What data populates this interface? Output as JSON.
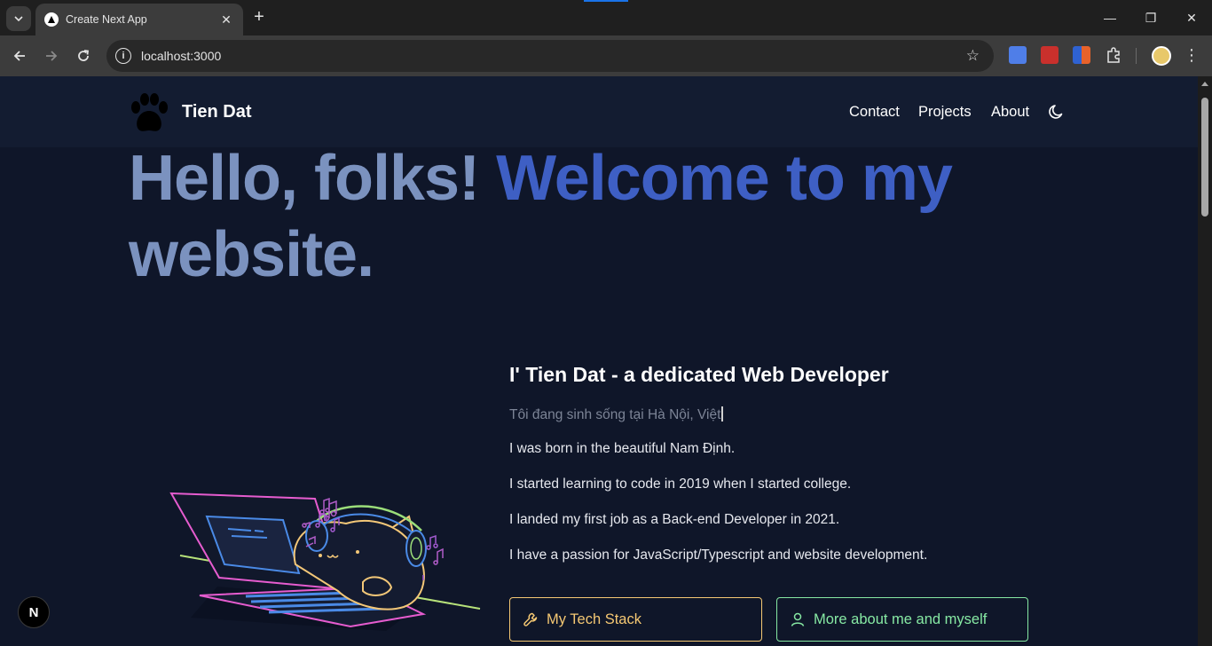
{
  "browser": {
    "tab_title": "Create Next App",
    "tab_close": "✕",
    "new_tab": "+",
    "url": "localhost:3000",
    "window_controls": {
      "minimize": "—",
      "restore": "❐",
      "close": "✕"
    }
  },
  "site": {
    "brand": "Tien Dat",
    "nav": [
      "Contact",
      "Projects",
      "About"
    ],
    "hero": {
      "part1": "Hello, folks! ",
      "part2": "Welcome to my",
      "part3": "website."
    },
    "intro": {
      "title": "I' Tien Dat - a dedicated Web Developer",
      "typing": "Tôi đang sinh sống tại  Hà Nội, Việt",
      "paragraphs": [
        "I was born in the beautiful Nam Định.",
        "I started learning to code in 2019 when I started college.",
        "I landed my first job as a Back-end Developer in 2021.",
        "I have a passion for JavaScript/Typescript and website development."
      ]
    },
    "buttons": {
      "tech_stack": "My Tech Stack",
      "about_me": "More about me and myself"
    },
    "next_badge": "N"
  },
  "colors": {
    "page_bg": "#0f1629",
    "header_bg": "#131c31",
    "hero_primary": "#7b92bf",
    "hero_accent": "#3e5fc4",
    "tech_stack_accent": "#f5c873",
    "about_accent": "#86e8a3"
  },
  "icons": {
    "brand_logo": "paw-icon",
    "theme_toggle": "moon-icon",
    "tech_stack": "wrench-icon",
    "about_me": "user-icon"
  }
}
